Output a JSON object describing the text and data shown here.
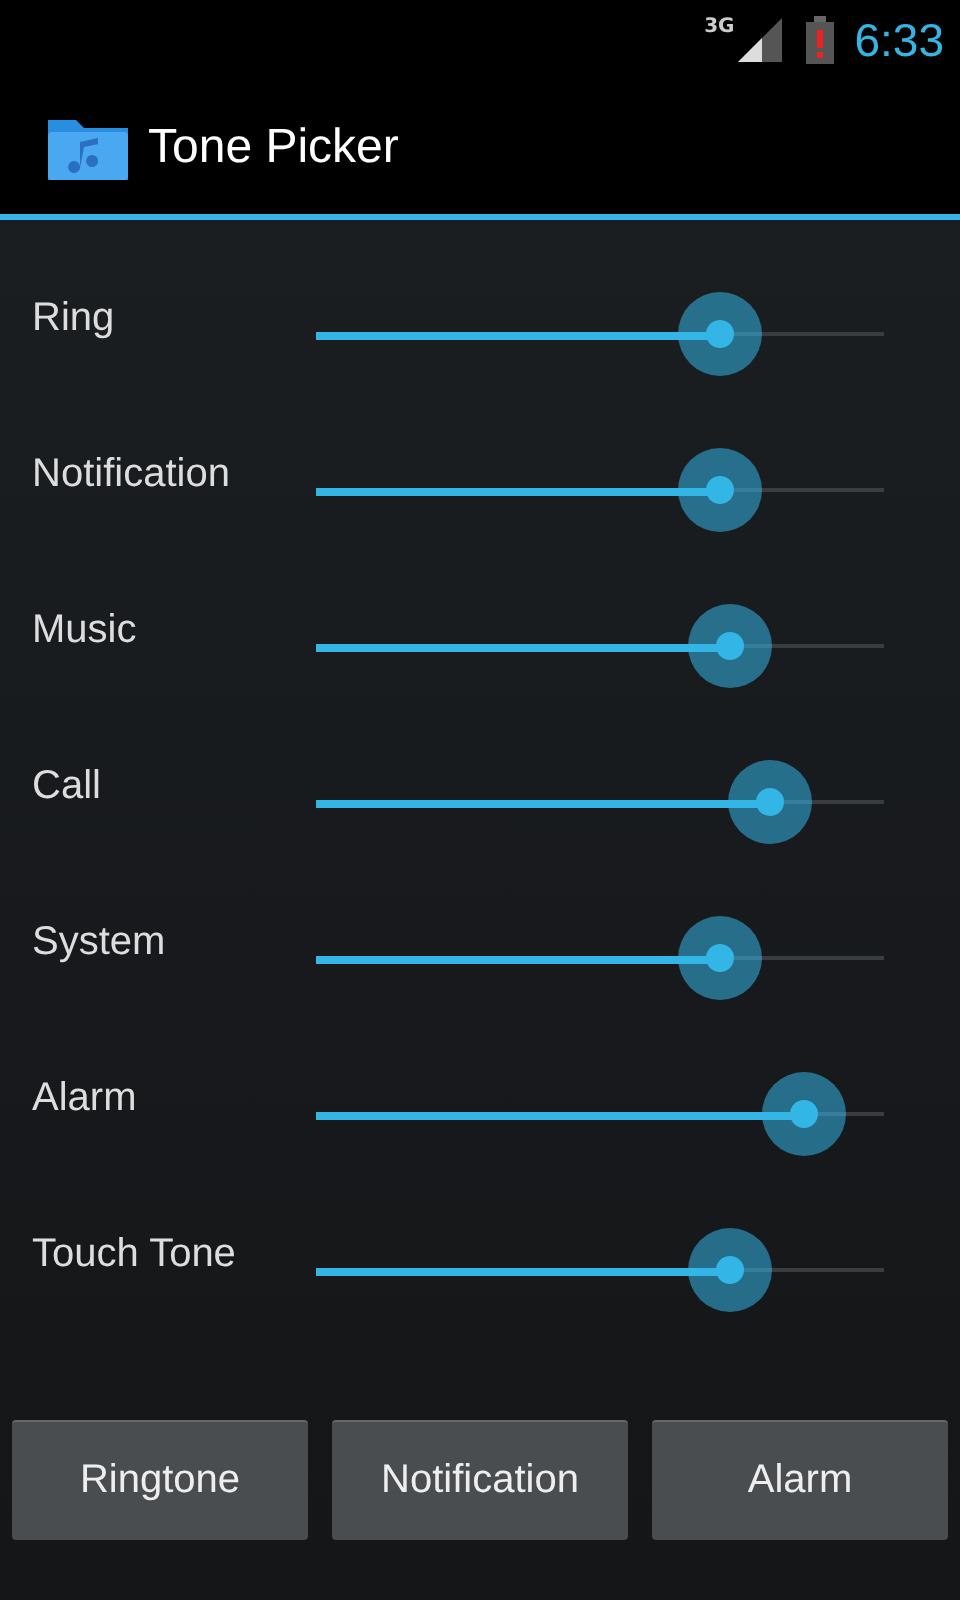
{
  "status_bar": {
    "network": "3G",
    "time": "6:33"
  },
  "app_bar": {
    "title": "Tone Picker"
  },
  "sliders": [
    {
      "label": "Ring",
      "level": 0.71
    },
    {
      "label": "Notification",
      "level": 0.71
    },
    {
      "label": "Music",
      "level": 0.73
    },
    {
      "label": "Call",
      "level": 0.8
    },
    {
      "label": "System",
      "level": 0.71
    },
    {
      "label": "Alarm",
      "level": 0.86
    },
    {
      "label": "Touch Tone",
      "level": 0.73
    }
  ],
  "buttons": [
    "Ringtone",
    "Notification",
    "Alarm"
  ]
}
